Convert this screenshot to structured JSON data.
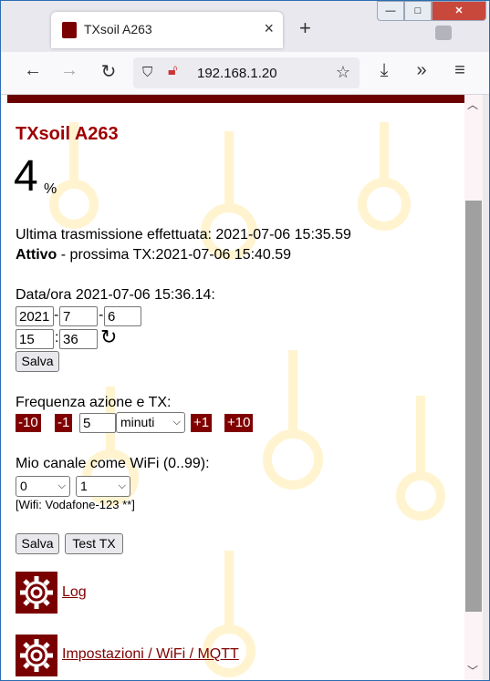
{
  "browser": {
    "tab_title": "TXsoil A263",
    "tab_close": "×",
    "new_tab": "+",
    "url": "192.168.1.20",
    "controls": {
      "minimize": "—",
      "maximize": "□",
      "close": "✕"
    }
  },
  "page": {
    "device_title": "TXsoil A263",
    "percent_value": "4",
    "percent_sign": "%",
    "last_tx_line": "Ultima trasmissione effettuata: 2021-07-06 15:35.59",
    "status_bold": "Attivo",
    "next_tx_text": " - prossima TX:2021-07-06 15:40.59",
    "datetime_label": "Data/ora 2021-07-06 15:36.14:",
    "date": {
      "year": "2021",
      "month": "7",
      "day": "6",
      "sep": "-"
    },
    "time": {
      "hour": "15",
      "minute": "36",
      "sep": ":"
    },
    "save_label": "Salva",
    "freq_label": "Frequenza azione e TX:",
    "freq_buttons": {
      "minus10": "-10",
      "minus1": "-1",
      "plus1": "+1",
      "plus10": "+10"
    },
    "freq_value": "5",
    "freq_unit": "minuti",
    "channel_label": "Mio canale come WiFi (0..99):",
    "channel_a": "0",
    "channel_b": "1",
    "wifi_info": "[Wifi: Vodafone-123 **]",
    "save2_label": "Salva",
    "test_tx_label": "Test TX",
    "log_link": "Log",
    "settings_link": "Impostazioni / WiFi / MQTT"
  },
  "colors": {
    "brand": "#7a0000",
    "title": "#a00000",
    "watermark": "#fff3c8"
  },
  "icons": [
    "thermometer-icon",
    "refresh-icon",
    "gear-icon",
    "shield-icon",
    "lock-icon",
    "star-icon",
    "download-icon",
    "menu-icon"
  ]
}
